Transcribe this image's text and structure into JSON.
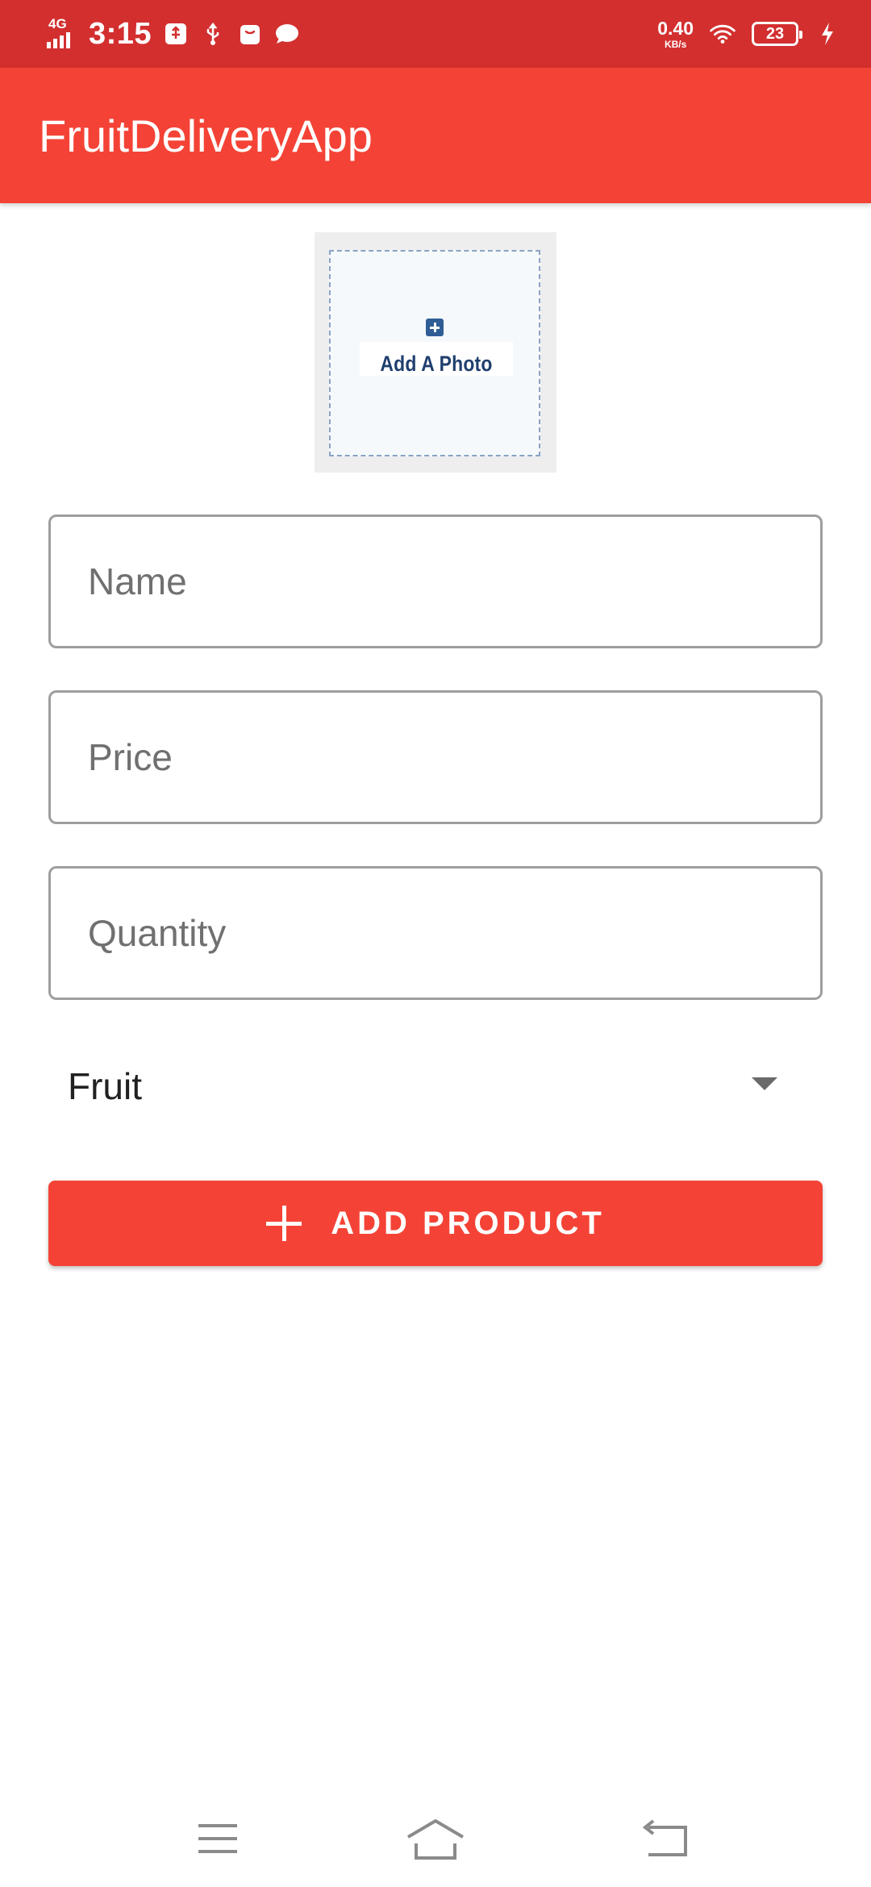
{
  "status_bar": {
    "network": "4G",
    "time": "3:15",
    "speed_value": "0.40",
    "speed_unit": "KB/s",
    "battery": "23"
  },
  "app_bar": {
    "title": "FruitDeliveryApp"
  },
  "photo_picker": {
    "label": "Add A Photo",
    "icon": "plus-square-icon"
  },
  "form": {
    "name_placeholder": "Name",
    "price_placeholder": "Price",
    "quantity_placeholder": "Quantity",
    "category_selected": "Fruit"
  },
  "add_button": {
    "label": "ADD PRODUCT",
    "icon": "plus-icon"
  },
  "colors": {
    "status_bar": "#d32f2f",
    "primary": "#f44336"
  }
}
